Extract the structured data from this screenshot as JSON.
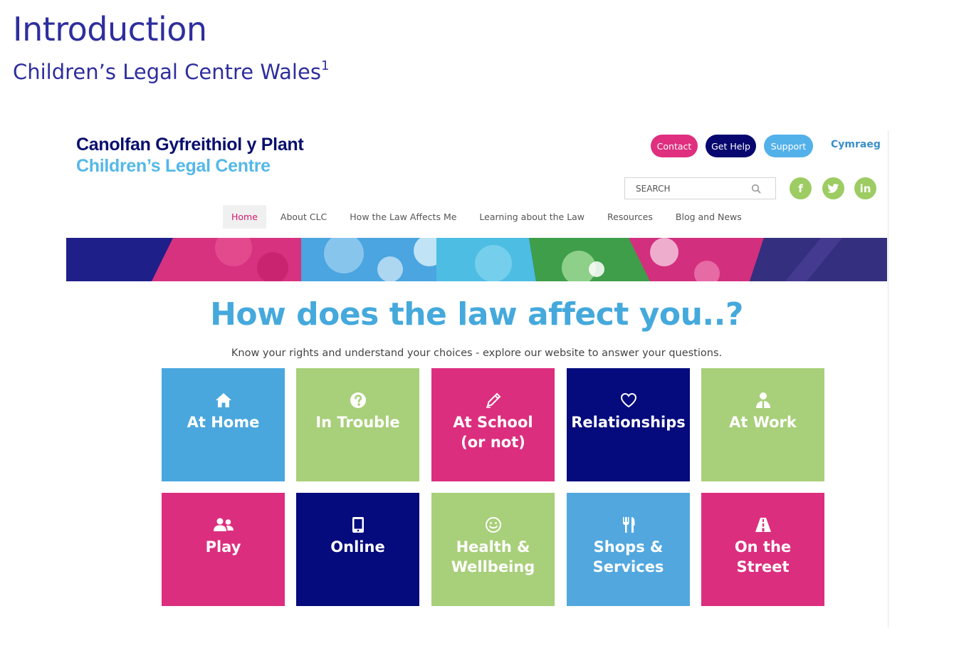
{
  "slide": {
    "title": "Introduction",
    "subtitle": "Children’s Legal Centre Wales",
    "footnote_marker": "1"
  },
  "site": {
    "logo_welsh": "Canolfan Gyfreithiol y Plant",
    "logo_english": "Children’s Legal Centre",
    "header_buttons": {
      "contact": "Contact",
      "get_help": "Get Help",
      "support": "Support"
    },
    "language_link": "Cymraeg",
    "search": {
      "placeholder": "SEARCH"
    },
    "social": {
      "facebook": "f",
      "twitter": "t",
      "linkedin": "in"
    },
    "nav": [
      {
        "label": "Home",
        "active": true
      },
      {
        "label": "About CLC",
        "active": false
      },
      {
        "label": "How the Law Affects Me",
        "active": false
      },
      {
        "label": "Learning about the Law",
        "active": false
      },
      {
        "label": "Resources",
        "active": false
      },
      {
        "label": "Blog and News",
        "active": false
      }
    ],
    "hero": {
      "heading": "How does the law affect you..?",
      "text": "Know your rights and understand your choices - explore our website to answer your questions."
    },
    "tiles": [
      {
        "label": "At Home",
        "icon": "home-icon",
        "color": "#4aa7dd"
      },
      {
        "label": "In Trouble",
        "icon": "question-circle-icon",
        "color": "#a8cf79"
      },
      {
        "label": "At School\n(or not)",
        "icon": "pencil-icon",
        "color": "#dc2e7e"
      },
      {
        "label": "Relationships",
        "icon": "heart-icon",
        "color": "#050a7c"
      },
      {
        "label": "At Work",
        "icon": "worker-icon",
        "color": "#a8cf79"
      },
      {
        "label": "Play",
        "icon": "group-icon",
        "color": "#dc2e7e"
      },
      {
        "label": "Online",
        "icon": "tablet-icon",
        "color": "#050a7c"
      },
      {
        "label": "Health &\nWellbeing",
        "icon": "smiley-icon",
        "color": "#a8cf79"
      },
      {
        "label": "Shops &\nServices",
        "icon": "cutlery-icon",
        "color": "#52a8de"
      },
      {
        "label": "On the\nStreet",
        "icon": "road-icon",
        "color": "#dc2e7e"
      }
    ]
  },
  "colors": {
    "slide_title": "#2e2e9e",
    "brand_navy": "#0a0f6e",
    "brand_light_blue": "#55b8e8",
    "pink": "#dc2e7e",
    "green": "#a8cf79"
  }
}
